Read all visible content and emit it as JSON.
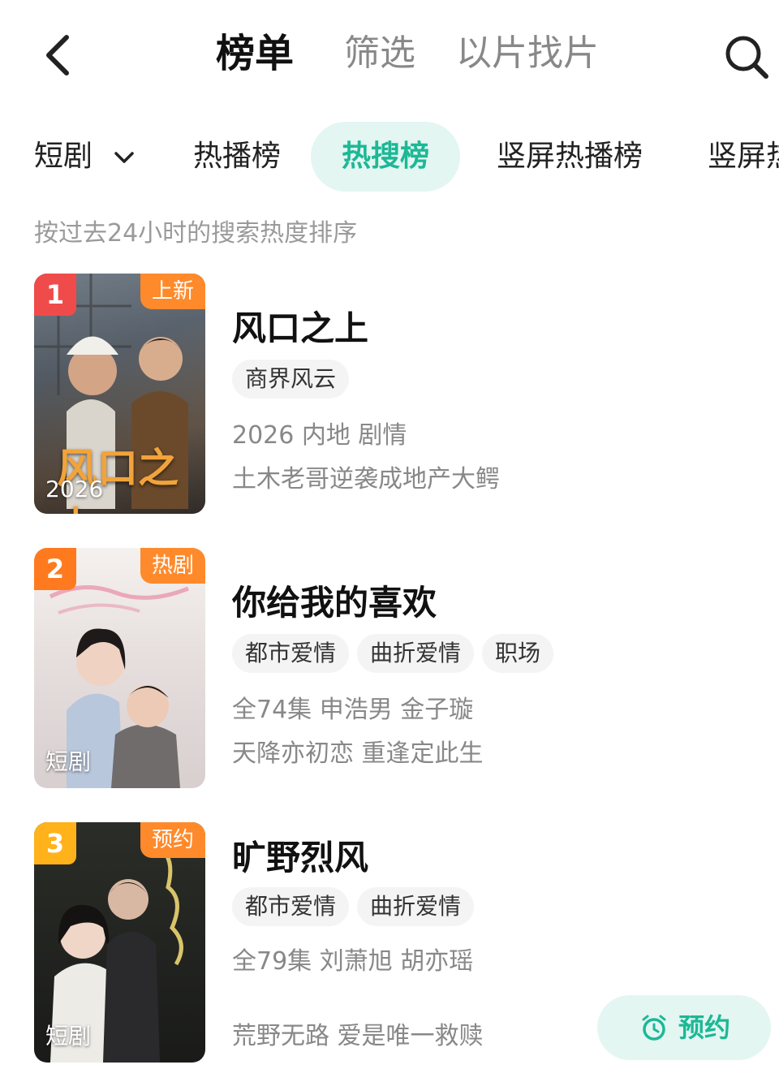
{
  "header": {
    "tabs": [
      {
        "label": "榜单",
        "active": true
      },
      {
        "label": "筛选",
        "active": false
      },
      {
        "label": "以片找片",
        "active": false
      }
    ]
  },
  "categories": {
    "dropdown": "短剧",
    "items": [
      {
        "label": "热播榜",
        "active": false
      },
      {
        "label": "热搜榜",
        "active": true
      },
      {
        "label": "竖屏热播榜",
        "active": false
      },
      {
        "label": "竖屏热",
        "active": false
      }
    ]
  },
  "hint": "按过去24小时的搜索热度排序",
  "list": [
    {
      "rank": "1",
      "corner_label": "上新",
      "poster_caption": "2026",
      "poster_title": "风口之上",
      "title": "风口之上",
      "tags": [
        "商界风云"
      ],
      "meta": "2026 内地 剧情",
      "desc": "土木老哥逆袭成地产大鳄"
    },
    {
      "rank": "2",
      "corner_label": "热剧",
      "poster_caption": "短剧",
      "title": "你给我的喜欢",
      "tags": [
        "都市爱情",
        "曲折爱情",
        "职场"
      ],
      "meta": "全74集 申浩男 金子璇",
      "desc": "天降亦初恋 重逢定此生"
    },
    {
      "rank": "3",
      "corner_label": "预约",
      "poster_caption": "短剧",
      "title": "旷野烈风",
      "tags": [
        "都市爱情",
        "曲折爱情"
      ],
      "meta": "全79集 刘萧旭 胡亦瑶",
      "desc": "荒野无路 爱是唯一救赎",
      "action": "预约"
    }
  ],
  "colors": {
    "accent": "#1db896",
    "accent_bg": "#e3f6f2",
    "rank1": "#f04b4b",
    "rank2": "#ff7a1f",
    "rank3": "#ffb21a",
    "corner": "#ff8a2b"
  }
}
